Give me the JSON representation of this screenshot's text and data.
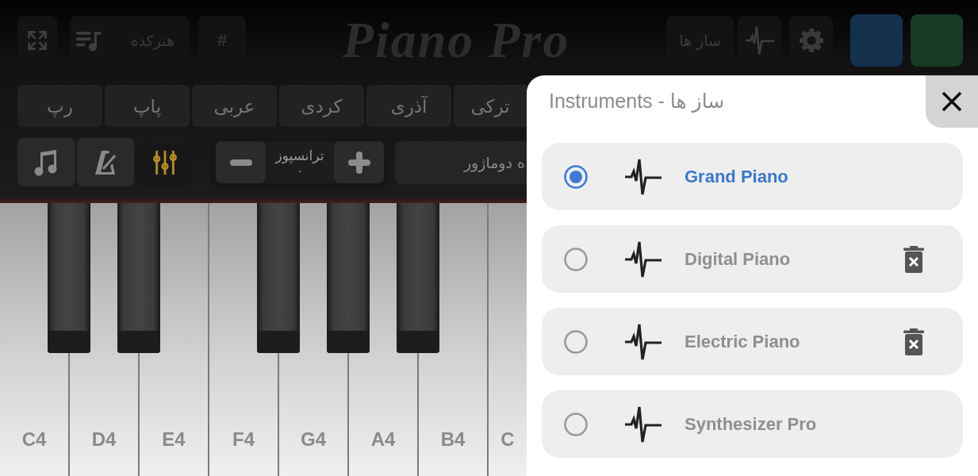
{
  "top_bar": {
    "right": [
      {
        "kind": "swatch",
        "color": "#153b24"
      },
      {
        "kind": "swatch",
        "color": "#13304d"
      },
      {
        "kind": "settings"
      },
      {
        "kind": "wave"
      },
      {
        "kind": "text",
        "label": "ساز ها"
      }
    ],
    "title": "Piano Pro",
    "left": [
      {
        "kind": "text",
        "label": "#"
      },
      {
        "kind": "library",
        "label": "هنرکده"
      },
      {
        "kind": "expand"
      }
    ]
  },
  "genre_tabs": [
    {
      "label": "ترکی",
      "selected": false
    },
    {
      "label": "آذری",
      "selected": false
    },
    {
      "label": "کردی",
      "selected": false
    },
    {
      "label": "عربی",
      "selected": false
    },
    {
      "label": "پاپ",
      "selected": false
    },
    {
      "label": "رپ",
      "selected": false
    }
  ],
  "toolbar": {
    "scale": {
      "value": "ه دوماژور"
    },
    "transpose": {
      "label": "ترانسپوز",
      "value": "۰"
    },
    "modes": [
      {
        "kind": "mixer",
        "selected": true
      },
      {
        "kind": "metronome",
        "selected": false
      },
      {
        "kind": "notes",
        "selected": false
      }
    ]
  },
  "piano": {
    "white_keys": [
      "C",
      "B4",
      "A4",
      "G4",
      "F4",
      "E4",
      "D4",
      "C4"
    ]
  },
  "instruments_dialog": {
    "title": "Instruments - ساز ها",
    "items": [
      {
        "name": "Grand Piano",
        "selected": true,
        "deletable": false
      },
      {
        "name": "Digital Piano",
        "selected": false,
        "deletable": true
      },
      {
        "name": "Electric Piano",
        "selected": false,
        "deletable": true
      },
      {
        "name": "Synthesizer Pro",
        "selected": false,
        "deletable": false
      }
    ]
  }
}
